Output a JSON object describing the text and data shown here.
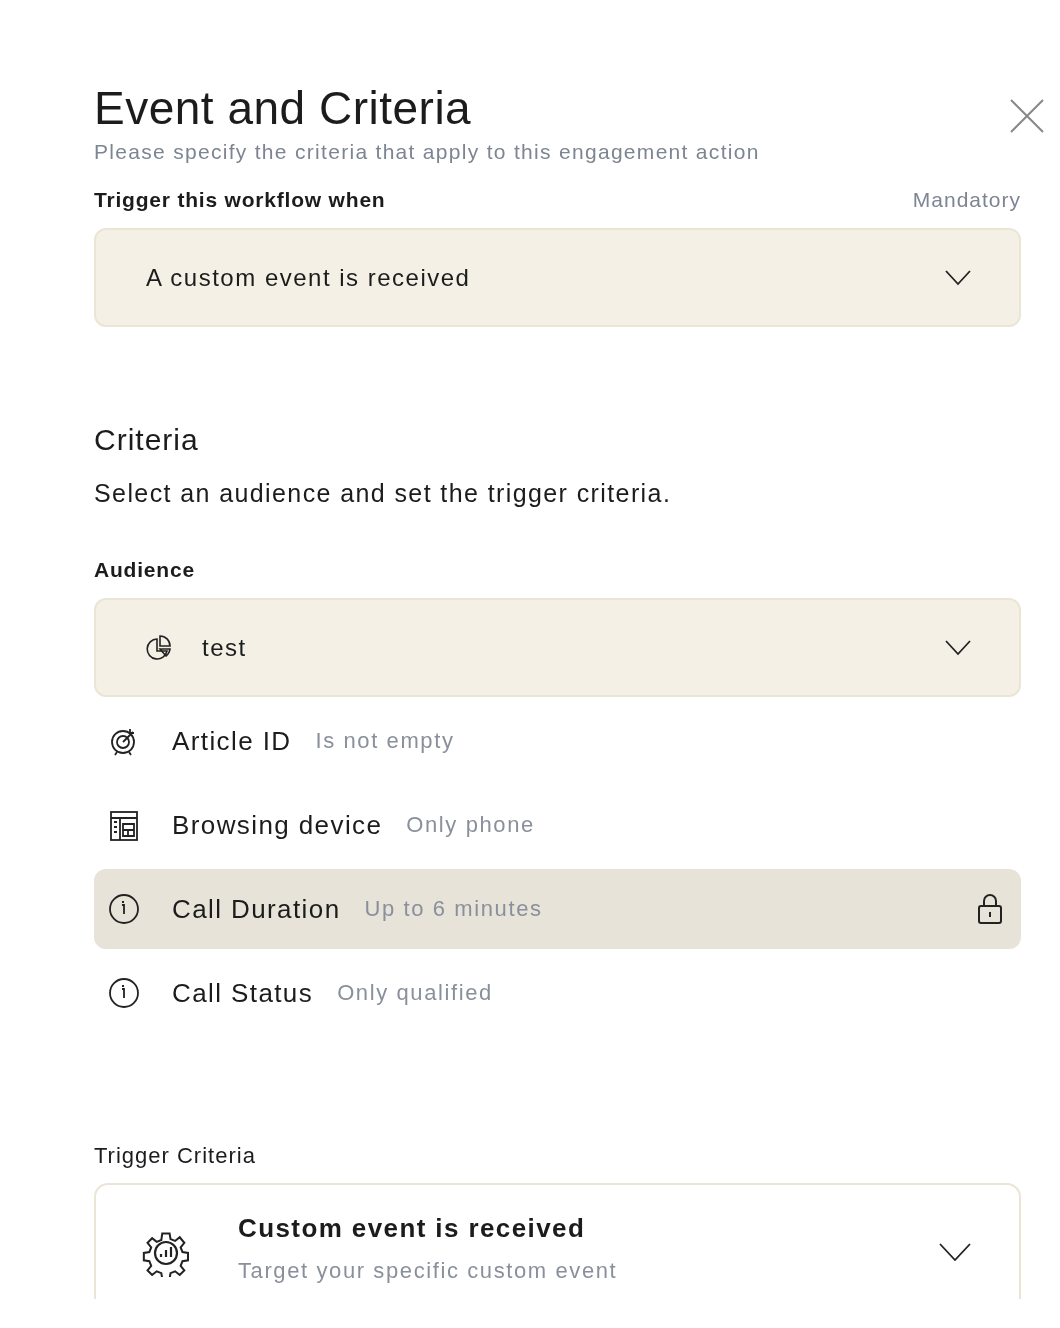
{
  "dialog": {
    "title": "Event and Criteria",
    "subtitle": "Please specify the criteria that apply to this engagement action"
  },
  "trigger": {
    "label": "Trigger this workflow when",
    "note": "Mandatory",
    "value": "A custom event is received"
  },
  "criteria": {
    "heading": "Criteria",
    "description": "Select an audience and set the trigger criteria."
  },
  "audience": {
    "label": "Audience",
    "value": "test",
    "rows": [
      {
        "name": "Article ID",
        "condition": "Is not empty",
        "selected": false,
        "locked": false
      },
      {
        "name": "Browsing device",
        "condition": "Only phone",
        "selected": false,
        "locked": false
      },
      {
        "name": "Call Duration",
        "condition": "Up to 6 minutes",
        "selected": true,
        "locked": true
      },
      {
        "name": "Call Status",
        "condition": "Only qualified",
        "selected": false,
        "locked": false
      }
    ]
  },
  "trigger_criteria": {
    "label": "Trigger Criteria",
    "title": "Custom event is received",
    "description": "Target your specific custom event"
  }
}
